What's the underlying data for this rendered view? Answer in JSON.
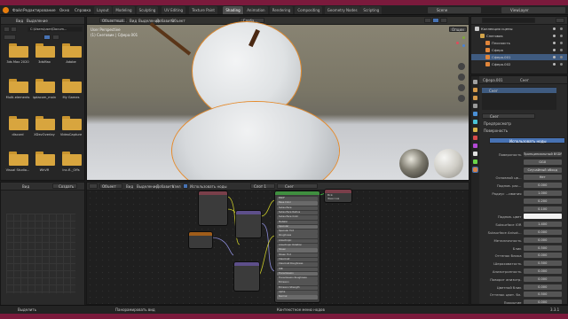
{
  "menu": [
    "Файл",
    "Редактирование",
    "Окно",
    "Справка"
  ],
  "workspaces": [
    "Layout",
    "Modeling",
    "Sculpting",
    "UV Editing",
    "Texture Paint",
    "Shading",
    "Animation",
    "Rendering",
    "Compositing",
    "Geometry Nodes",
    "Scripting"
  ],
  "active_workspace": "Shading",
  "scene": "Scene",
  "view_layer": "ViewLayer",
  "file_browser": {
    "menu": [
      "Вид",
      "Выделение"
    ],
    "path": "C:\\Users\\user\\Docum...",
    "folders": [
      [
        "3ds Max 2020",
        "3dsMax",
        "Adobe"
      ],
      [
        "Multi-elements",
        "igdacom_main",
        "My Games"
      ],
      [
        "discord",
        "XDevOverlay",
        "VideoCapture"
      ],
      [
        "Visual Studio...",
        "WhVR",
        "Inc-fl-_Offs"
      ]
    ]
  },
  "image_panel": {
    "menu": [
      "Вид"
    ],
    "label": "Создать"
  },
  "viewport": {
    "menu": [
      "Вид",
      "Выделение",
      "Добавить",
      "Объект"
    ],
    "mode": "Объектный...",
    "shading": "Глоба...",
    "info1": "User Perspective",
    "info2": "(1) Снеговик | Сфера.001",
    "options": "Опции"
  },
  "node_editor": {
    "menu": [
      "Объект",
      "Вид",
      "Выделение",
      "Добавить",
      "Узел"
    ],
    "use_nodes": "Использовать ноды",
    "slot": "Слот 1",
    "material": "Снег",
    "bsdf_title": "Principled BSDF",
    "output_title": "Material Output",
    "output_opts": [
      "Всё",
      "Эмиссия"
    ],
    "bsdf_inputs": [
      "BSDF",
      "Base Color",
      "Subsurface",
      "Subsurface Radius",
      "Subsurface Color",
      "Metallic",
      "Specular",
      "Specular Tint",
      "Roughness",
      "Anisotropic",
      "Anisotropic Rotation",
      "Sheen",
      "Sheen Tint",
      "Clearcoat",
      "Clearcoat Roughness",
      "IOR",
      "Transmission",
      "Transmission Roughness",
      "Emission",
      "Emission Strength",
      "Alpha",
      "Normal"
    ]
  },
  "outliner": {
    "items": [
      {
        "label": "Коллекция сцены",
        "sel": false,
        "indent": 0
      },
      {
        "label": "Снеговик",
        "sel": false,
        "indent": 1
      },
      {
        "label": "Плоскость",
        "sel": false,
        "indent": 2
      },
      {
        "label": "Сфера",
        "sel": false,
        "indent": 2
      },
      {
        "label": "Сфера.001",
        "sel": true,
        "indent": 2
      },
      {
        "label": "Сфера.002",
        "sel": false,
        "indent": 2
      }
    ]
  },
  "properties": {
    "object": "Сфера.001",
    "material": "Снег",
    "mat_slot": "Снег",
    "sections": {
      "preview": "Предпросмотр",
      "surface": "Поверхность"
    },
    "use_nodes": "Использовать ноды",
    "rows": [
      {
        "label": "Поверхность",
        "value": "Принципиальный BSDF"
      },
      {
        "label": "",
        "value": "GGX"
      },
      {
        "label": "",
        "value": "Случайный обход"
      },
      {
        "label": "Основной цв...",
        "value": "Нет"
      },
      {
        "label": "Подпов. рас...",
        "value": "0.000"
      },
      {
        "label": "Радиус ...ивания",
        "value": "1.000"
      },
      {
        "label": "",
        "value": "0.200"
      },
      {
        "label": "",
        "value": "0.100"
      },
      {
        "label": "Подпов. цвет",
        "value": ""
      },
      {
        "label": "Subsurface IOR",
        "value": "1.400"
      },
      {
        "label": "Subsurface Anisot...",
        "value": "0.000"
      },
      {
        "label": "Металличность",
        "value": "0.000"
      },
      {
        "label": "Блик",
        "value": "0.500"
      },
      {
        "label": "Оттенок блика",
        "value": "0.000"
      },
      {
        "label": "Шероховатость",
        "value": "0.500"
      },
      {
        "label": "Анизотропность",
        "value": "0.000"
      },
      {
        "label": "Поворот анизотр.",
        "value": "0.000"
      },
      {
        "label": "Цветной блик",
        "value": "0.000"
      },
      {
        "label": "Оттенок цвет. бл.",
        "value": "0.500"
      },
      {
        "label": "Покрытие",
        "value": "0.000"
      },
      {
        "label": "Шерох. покрытия",
        "value": "0.030"
      },
      {
        "label": "IOR",
        "value": "1.450"
      },
      {
        "label": "Пропускание",
        "value": "0.000"
      }
    ]
  },
  "status": {
    "left": "Выделить",
    "middle": "Панорамировать вид",
    "right": "Контекстное меню нодов",
    "version": "3.3.1"
  }
}
